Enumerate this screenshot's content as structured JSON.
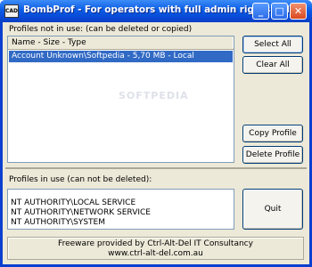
{
  "window": {
    "title": "BombProf - For operators with full admin rights only.",
    "icon_label": "CAD",
    "controls": {
      "minimize": "_",
      "maximize": "□",
      "close": "✕"
    }
  },
  "not_in_use": {
    "label": "Profiles not in use: (can be deleted or copied)",
    "column_header": "Name - Size - Type",
    "rows": [
      "Account Unknown\\Softpedia - 5,70 MB - Local"
    ],
    "watermark": "SOFTPEDIA"
  },
  "buttons": {
    "select_all": "Select All",
    "clear_all": "Clear All",
    "copy_profile": "Copy Profile",
    "delete_profile": "Delete Profile",
    "quit": "Quit"
  },
  "in_use": {
    "label": "Profiles in use (can not be deleted):",
    "rows": [
      "NT AUTHORITY\\LOCAL SERVICE",
      "NT AUTHORITY\\NETWORK SERVICE",
      "NT AUTHORITY\\SYSTEM"
    ]
  },
  "footer": {
    "line1": "Freeware provided by Ctrl-Alt-Del IT Consultancy",
    "line2": "www.ctrl-alt-del.com.au"
  },
  "colors": {
    "titlebar": "#0a5ce6",
    "selection": "#316ac5",
    "window_bg": "#ece9d8"
  }
}
